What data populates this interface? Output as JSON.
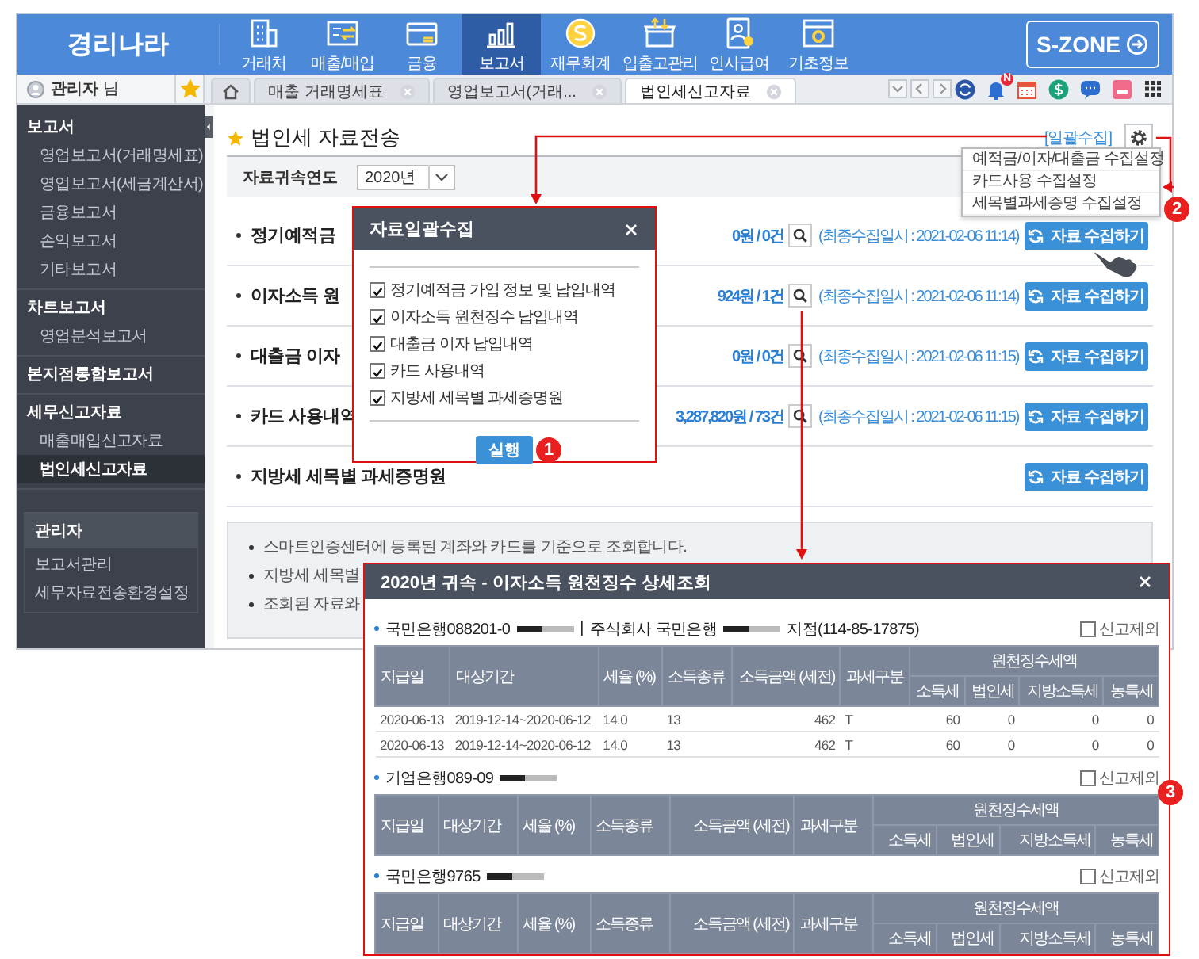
{
  "app": {
    "logo": "경리나라",
    "szone": "S-ZONE",
    "nav": [
      {
        "label": "거래처",
        "selected": false
      },
      {
        "label": "매출/매입",
        "selected": false
      },
      {
        "label": "금융",
        "selected": false
      },
      {
        "label": "보고서",
        "selected": true
      },
      {
        "label": "재무회계",
        "selected": false
      },
      {
        "label": "입출고관리",
        "selected": false
      },
      {
        "label": "인사급여",
        "selected": false
      },
      {
        "label": "기초정보",
        "selected": false
      }
    ]
  },
  "user": {
    "label": "**관리자** 님",
    "favorite": true
  },
  "tabs": [
    {
      "kind": "home",
      "selected": false
    },
    {
      "kind": "page",
      "label": "매출 거래명세표",
      "selected": false
    },
    {
      "kind": "page",
      "label": "영업보고서(거래...",
      "selected": false
    },
    {
      "kind": "page",
      "label": "법인세신고자료",
      "selected": true
    }
  ],
  "toolbar": {
    "badge": "N"
  },
  "sidebar": {
    "groups": [
      {
        "title": "보고서",
        "children": [
          {
            "label": "영업보고서(거래명세표)",
            "selected": false
          },
          {
            "label": "영업보고서(세금계산서)",
            "selected": false
          },
          {
            "label": "금융보고서",
            "selected": false
          },
          {
            "label": "손익보고서",
            "selected": false
          },
          {
            "label": "기타보고서",
            "selected": false
          }
        ]
      },
      {
        "title": "차트보고서",
        "children": [
          {
            "label": "영업분석보고서",
            "selected": false
          }
        ]
      },
      {
        "title": "본지점통합보고서"
      },
      {
        "title": "세무신고자료",
        "children": [
          {
            "label": "매출매입신고자료",
            "selected": false
          },
          {
            "label": "법인세신고자료",
            "selected": true
          }
        ]
      }
    ],
    "admin": {
      "title": "관리자",
      "items": [
        "보고서관리",
        "세무자료전송환경설정"
      ]
    }
  },
  "page": {
    "title": "법인세 자료전송",
    "bulk_link": "[일괄수집]",
    "year_label": "자료귀속연도",
    "year_value": "2020년",
    "rows": [
      {
        "title": "정기예적금",
        "amount": "0원 / 0건",
        "last_collected": "(최종수집일시 : 2021-02-06 11:14)",
        "button": "자료 수집하기"
      },
      {
        "title": "이자소득 원",
        "amount": "924원 / 1건",
        "last_collected": "(최종수집일시 : 2021-02-06 11:14)",
        "button": "자료 수집하기"
      },
      {
        "title": "대출금 이자",
        "amount": "0원 / 0건",
        "last_collected": "(최종수집일시 : 2021-02-06 11:15)",
        "button": "자료 수집하기"
      },
      {
        "title": "카드 사용내역",
        "amount": "3,287,820원 / 73건",
        "last_collected": "(최종수집일시 : 2021-02-06 11:15)",
        "button": "자료 수집하기"
      },
      {
        "title": "지방세 세목별 과세증명원",
        "button": "자료 수집하기"
      }
    ],
    "notes": [
      "스마트인증센터에 등록된 계좌와 카드를 기준으로 조회합니다.",
      "지방세 세목별",
      "조회된 자료와"
    ]
  },
  "settings_menu": [
    "예적금/이자/대출금 수집설정",
    "카드사용 수집설정",
    "세목별과세증명 수집설정"
  ],
  "bulk_dialog": {
    "title": "자료일괄수집",
    "run_button": "실행",
    "options": [
      {
        "label": "정기예적금 가입 정보 및 납입내역",
        "checked": true
      },
      {
        "label": "이자소득 원천징수 납입내역",
        "checked": true
      },
      {
        "label": "대출금 이자 납입내역",
        "checked": true
      },
      {
        "label": "카드 사용내역",
        "checked": true
      },
      {
        "label": "지방세 세목별 과세증명원",
        "checked": true
      }
    ]
  },
  "detail_popup": {
    "title": "2020년 귀속 - 이자소득 원천징수 상세조회",
    "sections": [
      {
        "account": [
          {
            "kind": "text",
            "text": "국민은행088201-0"
          },
          {
            "kind": "redacted"
          },
          {
            "kind": "text",
            "text": "|"
          },
          {
            "kind": "text",
            "text": "주식회사 국민은행"
          },
          {
            "kind": "redacted"
          },
          {
            "kind": "text",
            "text": "지점(114-85-17875)"
          }
        ],
        "exclude": {
          "label": "신고제외",
          "checked": false
        },
        "columns": [
          "지급일",
          "대상기간",
          "세율 (%)",
          "소득종류",
          "소득금액 (세전)",
          "과세구분"
        ],
        "tax_group": "원천징수세액",
        "tax_columns": [
          "소득세",
          "법인세",
          "지방소득세",
          "농특세"
        ],
        "rows": [
          [
            "2020-06-13",
            "2019-12-14~2020-06-12",
            "14.0",
            "13",
            "462",
            "T",
            "60",
            "0",
            "0",
            "0"
          ],
          [
            "2020-06-13",
            "2019-12-14~2020-06-12",
            "14.0",
            "13",
            "462",
            "T",
            "60",
            "0",
            "0",
            "0"
          ]
        ]
      },
      {
        "account": [
          {
            "kind": "text",
            "text": "기업은행089-09"
          },
          {
            "kind": "redacted"
          }
        ],
        "exclude": {
          "label": "신고제외",
          "checked": false
        },
        "columns": [
          "지급일",
          "대상기간",
          "세율 (%)",
          "소득종류",
          "소득금액 (세전)",
          "과세구분"
        ],
        "tax_group": "원천징수세액",
        "tax_columns": [
          "소득세",
          "법인세",
          "지방소득세",
          "농특세"
        ]
      },
      {
        "account": [
          {
            "kind": "text",
            "text": "국민은행9765"
          },
          {
            "kind": "redacted"
          }
        ],
        "exclude": {
          "label": "신고제외",
          "checked": false
        },
        "columns": [
          "지급일",
          "대상기간",
          "세율 (%)",
          "소득종류",
          "소득금액 (세전)",
          "과세구분"
        ],
        "tax_group": "원천징수세액",
        "tax_columns": [
          "소득세",
          "법인세",
          "지방소득세",
          "농특세"
        ]
      }
    ]
  },
  "annotations": [
    "1",
    "2",
    "3"
  ]
}
